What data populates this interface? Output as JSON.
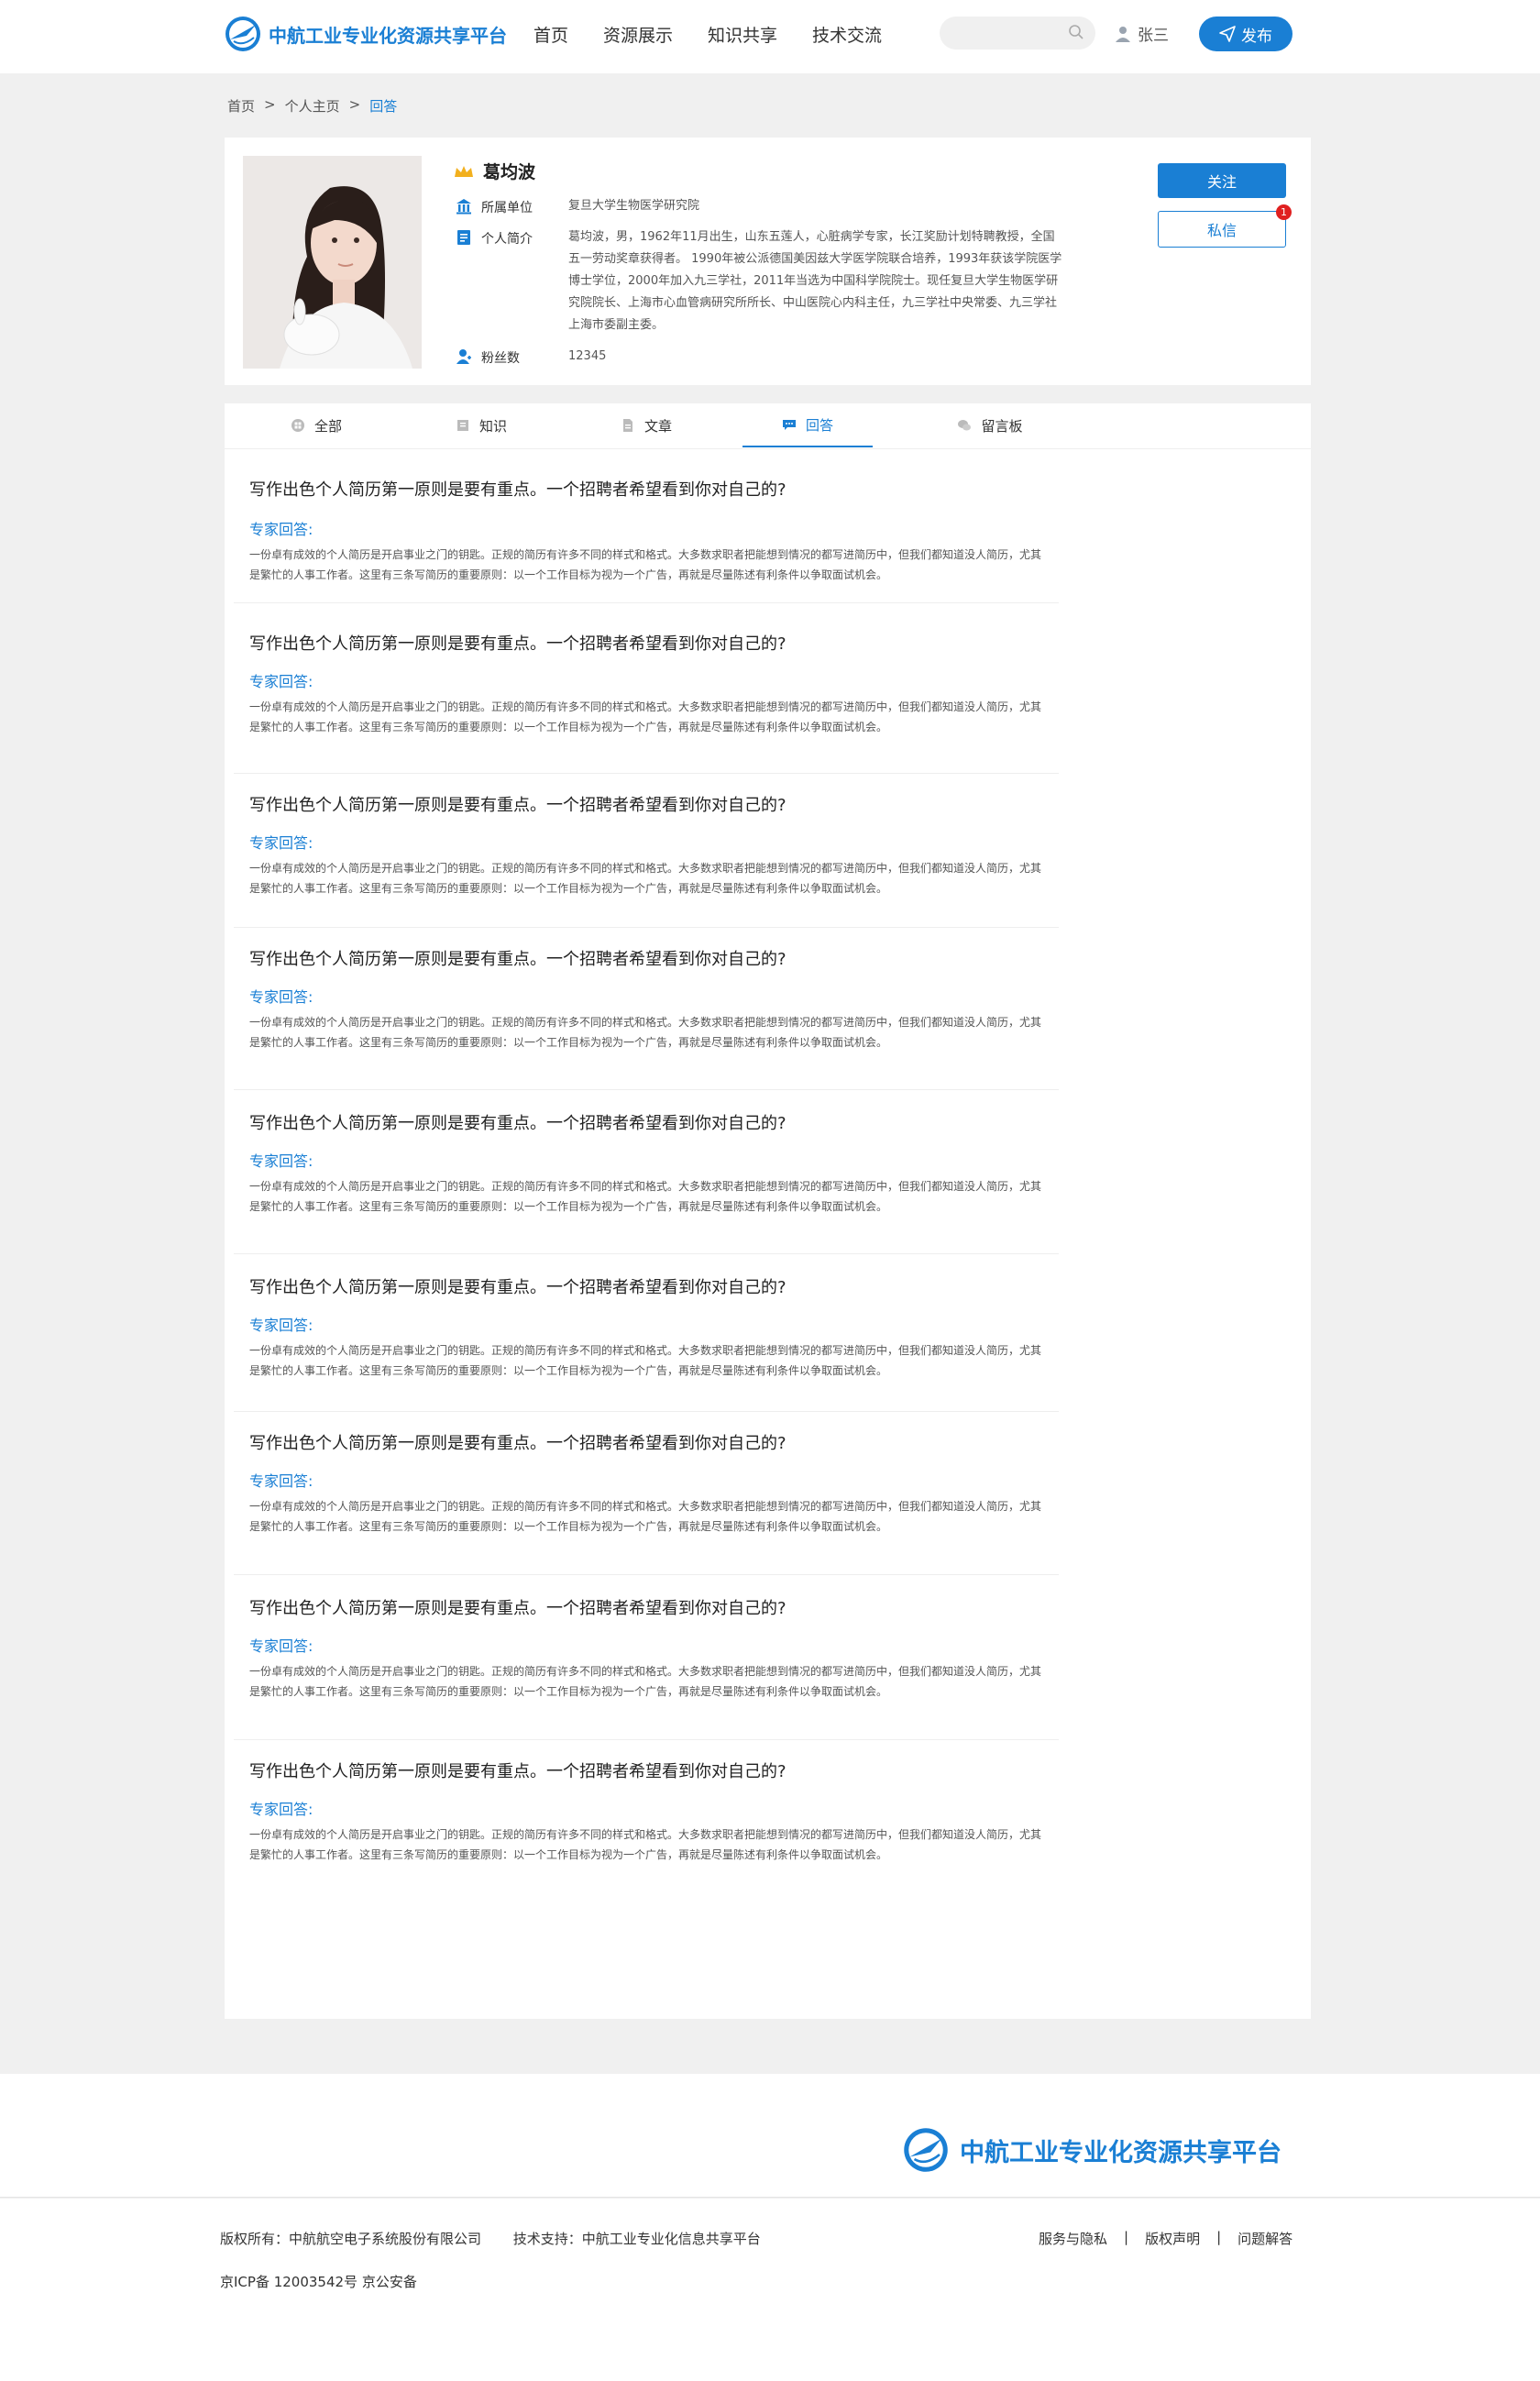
{
  "header": {
    "site_name": "中航工业专业化资源共享平台",
    "nav": [
      "首页",
      "资源展示",
      "知识共享",
      "技术交流"
    ],
    "search_placeholder": "",
    "user_name": "张三",
    "publish_label": "发布"
  },
  "breadcrumb": [
    "首页",
    ">",
    "个人主页",
    ">",
    "回答"
  ],
  "profile": {
    "name": "葛均波",
    "unit_label": "所属单位",
    "unit_value": "复旦大学生物医学研究院",
    "intro_label": "个人简介",
    "intro_value": "葛均波，男，1962年11月出生，山东五莲人，心脏病学专家，长江奖励计划特聘教授，全国五一劳动奖章获得者。 1990年被公派德国美因兹大学医学院联合培养，1993年获该学院医学博士学位，2000年加入九三学社，2011年当选为中国科学院院士。现任复旦大学生物医学研究院院长、上海市心血管病研究所所长、中山医院心内科主任，九三学社中央常委、九三学社上海市委副主委。",
    "fans_label": "粉丝数",
    "fans_value": "12345",
    "follow_label": "关注",
    "message_label": "私信",
    "message_badge": "1"
  },
  "tabs": [
    "全部",
    "知识",
    "文章",
    "回答",
    "留言板"
  ],
  "active_tab": "回答",
  "answers": {
    "title": "写作出色个人简历第一原则是要有重点。一个招聘者希望看到你对自己的?",
    "expert_label": "专家回答:",
    "text": "一份卓有成效的个人简历是开启事业之门的钥匙。正规的简历有许多不同的样式和格式。大多数求职者把能想到情况的都写进简历中，但我们都知道没人简历，尤其是繁忙的人事工作者。这里有三条写简历的重要原则：以一个工作目标为视为一个广告，再就是尽量陈述有利条件以争取面试机会。"
  },
  "footer": {
    "site_name": "中航工业专业化资源共享平台",
    "copyright": "版权所有：中航航空电子系统股份有限公司",
    "support": "技术支持：中航工业专业化信息共享平台",
    "icp": "京ICP备 12003542号 京公安备",
    "links": [
      "服务与隐私",
      "版权声明",
      "问题解答"
    ]
  },
  "colors": {
    "accent": "#1a7fd4",
    "badge": "#e02020"
  }
}
